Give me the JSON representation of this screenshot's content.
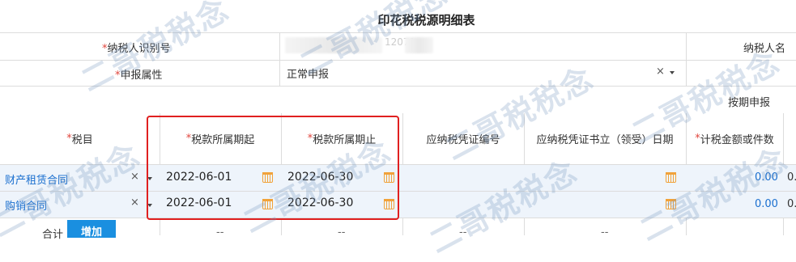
{
  "title": "印花税税源明细表",
  "form": {
    "taxpayer_id_label": "纳税人识别号",
    "taxpayer_id_value": "12071",
    "taxpayer_name_label": "纳税人名",
    "declare_attr_label": "申报属性",
    "declare_attr_value": "正常申报",
    "clear_symbol": "×",
    "period_mode": "按期申报",
    "required_mark": "*"
  },
  "table": {
    "headers": {
      "tax_item": "税目",
      "period_start": "税款所属期起",
      "period_end": "税款所属期止",
      "voucher_no": "应纳税凭证编号",
      "voucher_date": "应纳税凭证书立（领受）日期",
      "amount": "计税金额或件数"
    },
    "rows": [
      {
        "tax_item": "财产租赁合同",
        "start": "2022-06-01",
        "end": "2022-06-30",
        "amount": "0.00",
        "extra": "0."
      },
      {
        "tax_item": "购销合同",
        "start": "2022-06-01",
        "end": "2022-06-30",
        "amount": "0.00",
        "extra": "0."
      }
    ],
    "footer": {
      "total_label": "合计",
      "add_label": "增加",
      "dash": "--"
    }
  },
  "watermark_text": "二哥税税念",
  "colors": {
    "accent": "#1a8fe0",
    "link": "#1a6fcf",
    "required": "#e0463d",
    "highlight": "#e02020",
    "calendar": "#f1a23a",
    "row_bg": "#eef4fb"
  }
}
